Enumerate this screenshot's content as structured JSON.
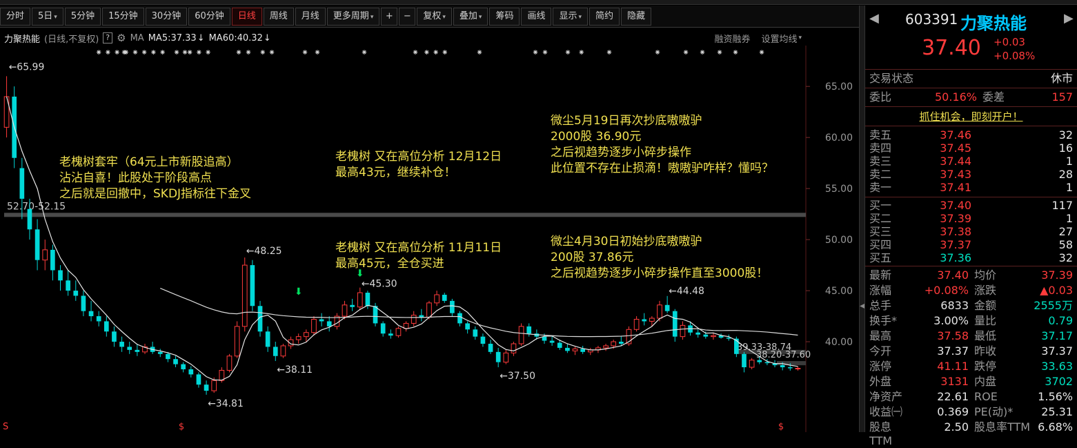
{
  "toolbar": {
    "items": [
      "分时",
      "5日",
      "5分钟",
      "15分钟",
      "30分钟",
      "60分钟",
      "日线",
      "周线",
      "月线",
      "更多周期",
      "+",
      "−",
      "复权",
      "叠加",
      "筹码",
      "画线",
      "显示",
      "简约",
      "隐藏"
    ],
    "active": "日线"
  },
  "info": {
    "name": "力聚热能",
    "mode": "(日线,不复权)",
    "help": "?",
    "ma_label": "MA",
    "ma5": "MA5:37.33",
    "ma60": "MA60:40.32",
    "margin": "融资融券",
    "set_ma": "设置均线"
  },
  "chart_data": {
    "type": "candlestick",
    "ylim": [
      32.5,
      69
    ],
    "y_ticks": [
      "65.00",
      "60.00",
      "55.00",
      "50.00",
      "45.00",
      "40.00"
    ],
    "price_labels": {
      "high1": "65.99",
      "peak2": "48.25",
      "low1": "34.81",
      "low2": "38.11",
      "high3": "45.30",
      "low3": "37.50",
      "high4": "44.48"
    },
    "band1": "52.70-52.15",
    "band2": "39.33-38.74",
    "band3": "38.20-37.60",
    "series": [
      {
        "values": [
          [
            61,
            66.0,
            60,
            64
          ],
          [
            64,
            65,
            57,
            58
          ],
          [
            57,
            58,
            52,
            54
          ],
          [
            53,
            54,
            50,
            51
          ],
          [
            51,
            52,
            47,
            48
          ],
          [
            48,
            50,
            47,
            49
          ],
          [
            49,
            49.5,
            46,
            47
          ],
          [
            47,
            47.5,
            45,
            46
          ],
          [
            46,
            47,
            44.5,
            45
          ],
          [
            45,
            46,
            44,
            44.5
          ],
          [
            44.5,
            45,
            42.5,
            43
          ],
          [
            43,
            44,
            42,
            42.5
          ],
          [
            42.5,
            43,
            41.5,
            42
          ],
          [
            42,
            42.5,
            40.5,
            41
          ],
          [
            41,
            41.5,
            39.5,
            40
          ],
          [
            40,
            40.5,
            39,
            39.5
          ],
          [
            39.5,
            40,
            38.8,
            39.2
          ],
          [
            39.2,
            39.8,
            38.6,
            39.0
          ],
          [
            39.0,
            39.8,
            38.8,
            39.5
          ],
          [
            39.5,
            40,
            38.8,
            39.0
          ],
          [
            39.0,
            39.3,
            38.5,
            38.8
          ],
          [
            38.8,
            39.0,
            38.0,
            38.3
          ],
          [
            38.3,
            38.6,
            37.5,
            37.8
          ],
          [
            37.8,
            38.0,
            37.0,
            37.3
          ],
          [
            37.3,
            37.6,
            36.5,
            36.8
          ],
          [
            36.8,
            37.0,
            35.5,
            35.8
          ],
          [
            35.8,
            36.2,
            34.81,
            35.2
          ],
          [
            35.2,
            36.5,
            35.0,
            36.2
          ],
          [
            36.2,
            37.5,
            36.0,
            37.2
          ],
          [
            37.2,
            38.8,
            37.0,
            38.6
          ],
          [
            38.6,
            42.0,
            38.4,
            41.5
          ],
          [
            41.5,
            48.25,
            41.0,
            47.5
          ],
          [
            47.5,
            48.0,
            43.0,
            43.5
          ],
          [
            43.5,
            44.0,
            40.5,
            41.0
          ],
          [
            41.0,
            41.5,
            39.0,
            39.5
          ],
          [
            39.5,
            40.0,
            38.11,
            38.6
          ],
          [
            38.6,
            39.8,
            38.4,
            39.6
          ],
          [
            39.6,
            40.5,
            39.3,
            40.2
          ],
          [
            40.2,
            40.8,
            39.8,
            40.5
          ],
          [
            40.5,
            41.2,
            40.0,
            40.9
          ],
          [
            40.9,
            42.5,
            40.6,
            42.2
          ],
          [
            42.2,
            42.8,
            41.5,
            42.0
          ],
          [
            42.0,
            42.5,
            41.0,
            41.5
          ],
          [
            41.5,
            42.8,
            41.2,
            42.5
          ],
          [
            42.5,
            44.0,
            42.2,
            43.6
          ],
          [
            43.6,
            44.2,
            43.0,
            43.4
          ],
          [
            43.4,
            45.3,
            43.1,
            44.8
          ],
          [
            44.8,
            45.0,
            43.2,
            43.5
          ],
          [
            43.5,
            43.8,
            41.5,
            41.8
          ],
          [
            41.8,
            42.0,
            40.5,
            40.8
          ],
          [
            40.8,
            41.2,
            40.3,
            40.6
          ],
          [
            40.6,
            41.5,
            40.4,
            41.3
          ],
          [
            41.3,
            42.0,
            41.0,
            41.8
          ],
          [
            41.8,
            43.0,
            41.5,
            42.6
          ],
          [
            42.6,
            43.2,
            42.0,
            42.4
          ],
          [
            42.4,
            44.0,
            42.2,
            43.8
          ],
          [
            43.8,
            45.0,
            43.5,
            44.6
          ],
          [
            44.6,
            44.8,
            43.8,
            44.0
          ],
          [
            44.0,
            44.2,
            42.5,
            42.8
          ],
          [
            42.8,
            43.0,
            41.5,
            41.8
          ],
          [
            41.8,
            42.0,
            40.8,
            41.2
          ],
          [
            41.2,
            41.5,
            40.2,
            40.5
          ],
          [
            40.5,
            40.8,
            39.5,
            39.8
          ],
          [
            39.8,
            40.2,
            38.8,
            39.0
          ],
          [
            39.0,
            39.4,
            37.5,
            38.0
          ],
          [
            38.0,
            39.2,
            37.8,
            38.9
          ],
          [
            38.9,
            40.0,
            38.6,
            39.8
          ],
          [
            39.8,
            41.8,
            39.6,
            41.5
          ],
          [
            41.5,
            41.8,
            40.5,
            40.8
          ],
          [
            40.8,
            41.2,
            40.2,
            40.5
          ],
          [
            40.5,
            40.8,
            39.8,
            40.1
          ],
          [
            40.1,
            40.6,
            39.6,
            39.9
          ],
          [
            39.9,
            40.2,
            39.2,
            39.4
          ],
          [
            39.4,
            39.8,
            38.9,
            39.1
          ],
          [
            39.1,
            39.5,
            38.7,
            39.3
          ],
          [
            39.3,
            39.6,
            38.8,
            39.0
          ],
          [
            39.0,
            39.4,
            38.7,
            39.2
          ],
          [
            39.2,
            39.6,
            38.9,
            39.4
          ],
          [
            39.4,
            39.8,
            39.1,
            39.6
          ],
          [
            39.6,
            40.2,
            39.3,
            40.0
          ],
          [
            40.0,
            40.5,
            39.6,
            39.8
          ],
          [
            39.8,
            41.5,
            39.6,
            41.2
          ],
          [
            41.2,
            42.5,
            41.0,
            42.2
          ],
          [
            42.2,
            42.8,
            41.6,
            42.0
          ],
          [
            42.0,
            42.5,
            41.5,
            42.3
          ],
          [
            42.3,
            44.0,
            42.0,
            43.6
          ],
          [
            43.6,
            44.48,
            42.8,
            43.0
          ],
          [
            43.0,
            43.2,
            40.0,
            40.5
          ],
          [
            40.5,
            42.0,
            40.2,
            41.6
          ],
          [
            41.6,
            42.0,
            40.6,
            40.9
          ],
          [
            40.9,
            41.2,
            40.4,
            40.7
          ],
          [
            40.7,
            41.0,
            40.3,
            40.5
          ],
          [
            40.5,
            40.9,
            40.2,
            40.6
          ],
          [
            40.6,
            40.8,
            40.3,
            40.4
          ],
          [
            40.4,
            40.7,
            40.1,
            40.3
          ],
          [
            40.3,
            40.5,
            38.5,
            38.8
          ],
          [
            38.8,
            39.0,
            37.0,
            37.5
          ],
          [
            37.5,
            38.4,
            37.3,
            38.2
          ],
          [
            38.2,
            38.6,
            37.8,
            38.0
          ],
          [
            38.0,
            38.3,
            37.7,
            37.9
          ],
          [
            37.9,
            38.2,
            37.5,
            37.7
          ],
          [
            37.7,
            38.0,
            37.2,
            37.5
          ],
          [
            37.5,
            37.9,
            37.17,
            37.4
          ],
          [
            37.37,
            37.58,
            37.17,
            37.4
          ]
        ]
      }
    ]
  },
  "annotations": {
    "a1": [
      "老槐树套牢（64元上市新股追高）",
      "沾沾自喜！此股处于阶段高点",
      "之后就是回撤中，SKDJ指标往下金叉"
    ],
    "a2": [
      "老槐树 又在高位分析 12月12日",
      "最高43元，继续补仓！"
    ],
    "a3": [
      "老槐树 又在高位分析 11月11日",
      "最高45元，全仓买进"
    ],
    "a4": [
      "微尘5月19日再次抄底嗷嗷驴",
      "2000股  36.90元",
      "之后视趋势逐步小碎步操作",
      "此位置不存在止损滴！嗷嗷驴咋样？懂吗？"
    ],
    "a5": [
      "微尘4月30日初始抄底嗷嗷驴",
      "200股  37.86元",
      "之后视趋势逐步小碎步操作直至3000股！"
    ]
  },
  "stock": {
    "code": "603391",
    "name": "力聚热能",
    "price": "37.40",
    "change": "+0.03",
    "change_pct": "+0.08%",
    "status_label": "交易状态",
    "status_value": "休市",
    "webi_label": "委比",
    "webi_value": "50.16%",
    "weicha_label": "委差",
    "weicha_value": "157",
    "banner": "抓住机会，即刻开户！",
    "asks": [
      {
        "label": "卖五",
        "price": "37.46",
        "vol": "32"
      },
      {
        "label": "卖四",
        "price": "37.45",
        "vol": "16"
      },
      {
        "label": "卖三",
        "price": "37.44",
        "vol": "1"
      },
      {
        "label": "卖二",
        "price": "37.43",
        "vol": "28"
      },
      {
        "label": "卖一",
        "price": "37.41",
        "vol": "1"
      }
    ],
    "bids": [
      {
        "label": "买一",
        "price": "37.40",
        "vol": "117"
      },
      {
        "label": "买二",
        "price": "37.39",
        "vol": "1"
      },
      {
        "label": "买三",
        "price": "37.38",
        "vol": "27"
      },
      {
        "label": "买四",
        "price": "37.37",
        "vol": "58"
      },
      {
        "label": "买五",
        "price": "37.36",
        "vol": "32"
      }
    ],
    "stats": [
      {
        "l1": "最新",
        "v1": "37.40",
        "c1": "red",
        "l2": "均价",
        "v2": "37.39",
        "c2": "red"
      },
      {
        "l1": "涨幅",
        "v1": "+0.08%",
        "c1": "red",
        "l2": "涨跌",
        "v2": "▲0.03",
        "c2": "red"
      },
      {
        "l1": "总手",
        "v1": "6833",
        "c1": "white",
        "l2": "金额",
        "v2": "2555万",
        "c2": "green"
      },
      {
        "l1": "换手*",
        "v1": "3.00%",
        "c1": "white",
        "l2": "量比",
        "v2": "0.79",
        "c2": "green"
      },
      {
        "l1": "最高",
        "v1": "37.58",
        "c1": "red",
        "l2": "最低",
        "v2": "37.17",
        "c2": "green"
      },
      {
        "l1": "今开",
        "v1": "37.37",
        "c1": "white",
        "l2": "昨收",
        "v2": "37.37",
        "c2": "white"
      },
      {
        "l1": "涨停",
        "v1": "41.11",
        "c1": "red",
        "l2": "跌停",
        "v2": "33.63",
        "c2": "green"
      },
      {
        "l1": "外盘",
        "v1": "3131",
        "c1": "red",
        "l2": "内盘",
        "v2": "3702",
        "c2": "green"
      },
      {
        "l1": "净资产",
        "v1": "22.61",
        "c1": "white",
        "l2": "ROE",
        "v2": "1.56%",
        "c2": "white"
      },
      {
        "l1": "收益㈠",
        "v1": "0.369",
        "c1": "white",
        "l2": "PE(动)*",
        "v2": "25.31",
        "c2": "white"
      },
      {
        "l1": "股息TTM",
        "v1": "2.50",
        "c1": "white",
        "l2": "股息率TTM",
        "v2": "6.68%",
        "c2": "white"
      }
    ]
  },
  "colors": {
    "up": "#ff3b3b",
    "down": "#00d8d8",
    "annotation": "#f0e050"
  }
}
